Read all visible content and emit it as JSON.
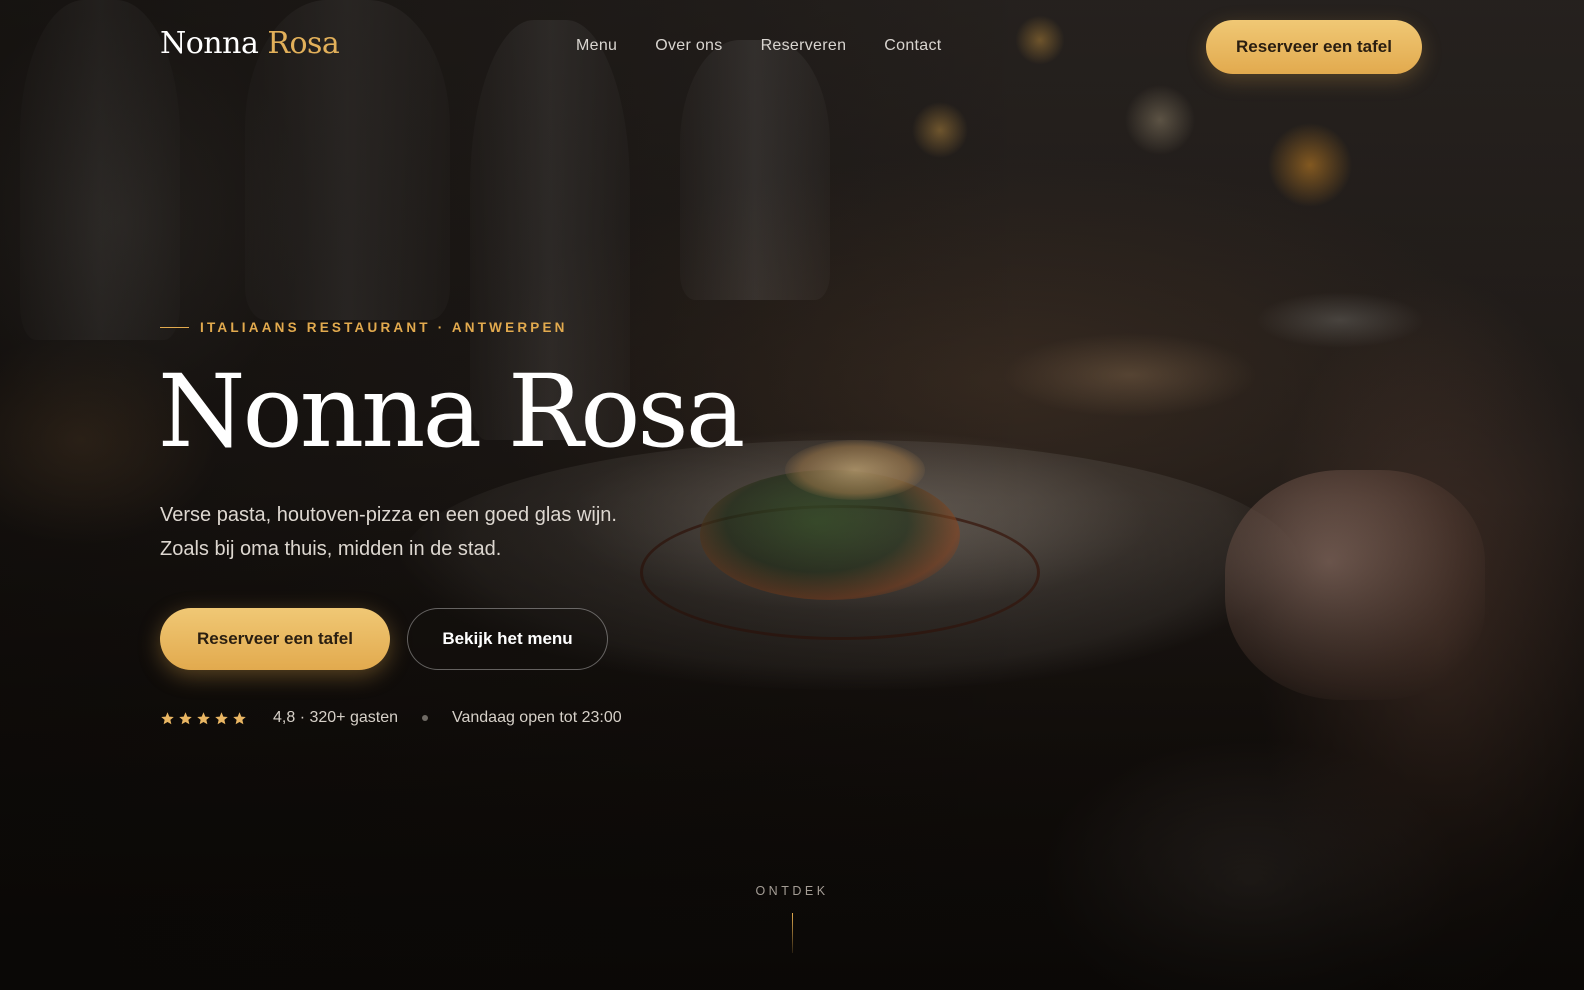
{
  "brand": {
    "name_part1": "Nonna",
    "name_part2": "Rosa",
    "accent_color": "#e2aa4e"
  },
  "nav": {
    "items": [
      {
        "label": "Menu"
      },
      {
        "label": "Over ons"
      },
      {
        "label": "Reserveren"
      },
      {
        "label": "Contact"
      }
    ],
    "cta_label": "Reserveer een tafel"
  },
  "hero": {
    "eyebrow": "ITALIAANS RESTAURANT · ANTWERPEN",
    "title": "Nonna Rosa",
    "subtitle": "Verse pasta, houtoven-pizza en een goed glas wijn. Zoals bij oma thuis, midden in de stad.",
    "primary_button": "Reserveer een tafel",
    "secondary_button": "Bekijk het menu",
    "rating": {
      "stars": 5,
      "text": "4,8 · 320+ gasten"
    },
    "opening_text": "Vandaag open tot 23:00",
    "scroll_label": "ONTDEK"
  },
  "icons": {
    "rating_star": "star-icon"
  }
}
